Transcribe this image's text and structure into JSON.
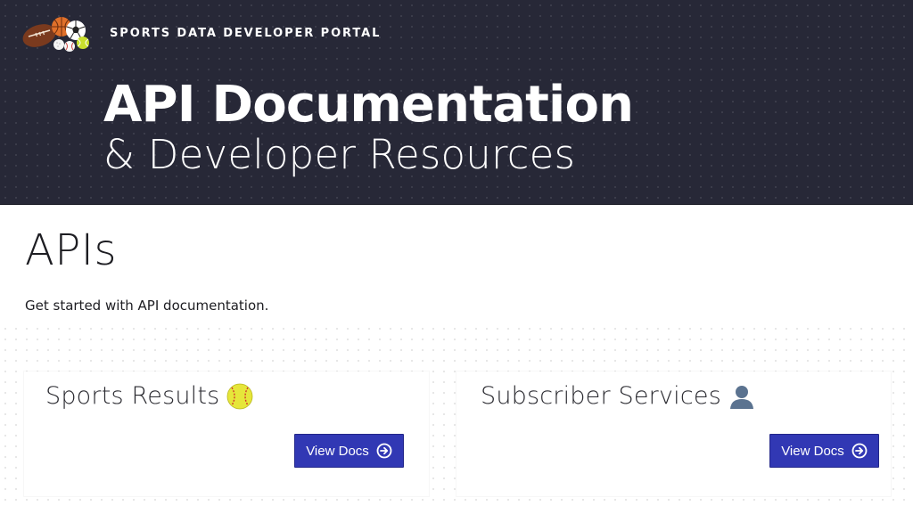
{
  "header": {
    "portal_title": "SPORTS DATA DEVELOPER PORTAL",
    "hero_title": "API Documentation",
    "hero_subtitle": "& Developer Resources",
    "logo_icon": "sports-balls-icon"
  },
  "main": {
    "heading": "APIs",
    "description": "Get started with API documentation.",
    "cards": [
      {
        "title": "Sports Results",
        "icon": "softball-icon",
        "button_label": "View Docs"
      },
      {
        "title": "Subscriber Services",
        "icon": "user-silhouette-icon",
        "button_label": "View Docs"
      }
    ]
  },
  "colors": {
    "header_bg": "#272837",
    "button_bg": "#3138b4",
    "text_dark": "#1d1d22"
  }
}
